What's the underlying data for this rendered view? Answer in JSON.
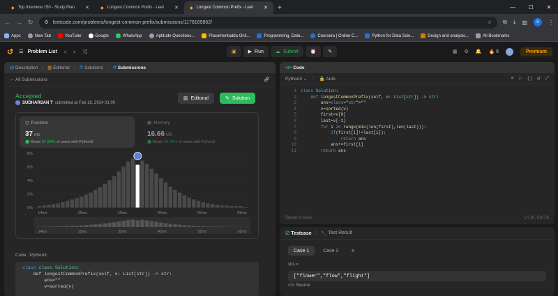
{
  "browser": {
    "tabs": [
      {
        "title": "Top Interview 150 - Study Plan",
        "active": false
      },
      {
        "title": "Longest Common Prefix - Leet",
        "active": false
      },
      {
        "title": "Longest Common Prefix - Leet",
        "active": true
      }
    ],
    "url": "leetcode.com/problems/longest-common-prefix/submissions/1178189862/",
    "profile_initial": "S",
    "bookmarks": [
      "Apps",
      "New Tab",
      "YouTube",
      "Google",
      "WhatsApp",
      "Aptitude Questions...",
      "Placementadda Onli...",
      "Programming, Data...",
      "Coursera | Online C...",
      "Python for Data Scie...",
      "Design and analysis..."
    ],
    "all_bookmarks": "All Bookmarks"
  },
  "header": {
    "problem_list": "Problem List",
    "run": "Run",
    "submit": "Submit",
    "streak": "0",
    "premium": "Premium"
  },
  "left": {
    "tabs": [
      "Description",
      "Editorial",
      "Solutions",
      "Submissions"
    ],
    "all_submissions": "All Submissions",
    "status": "Accepted",
    "user": "SUDHARSAN T",
    "submitted_text": "submitted at Feb 18, 2024 01:00",
    "editorial_btn": "Editorial",
    "solution_btn": "Solution",
    "runtime": {
      "label": "Runtime",
      "value": "37",
      "unit": "ms",
      "beats_prefix": "Beats",
      "beats_pct": "67.96%",
      "beats_suffix": "of users with Python3"
    },
    "memory": {
      "label": "Memory",
      "value": "16.66",
      "unit": "MB",
      "beats_prefix": "Beats",
      "beats_pct": "49.85%",
      "beats_suffix": "of users with Python3"
    },
    "code_label": "Code",
    "code_lang": "Python3",
    "code_preview": [
      "class Solution:",
      "    def longestCommonPrefix(self, v: List[str]) -> str:",
      "        ans=\"\"",
      "        v=sorted(v)"
    ]
  },
  "chart_data": {
    "type": "bar",
    "title": "",
    "xlabel": "",
    "ylabel": "",
    "y_ticks": [
      "8%",
      "6%",
      "4%",
      "2%",
      "0%"
    ],
    "ylim": [
      0,
      8
    ],
    "x_ticks": [
      "14ms",
      "25ms",
      "35ms",
      "45ms",
      "55ms",
      "65ms"
    ],
    "highlight_bar_value": 6.3,
    "bar_values": [
      0.2,
      0.3,
      0.4,
      0.5,
      0.6,
      0.8,
      1.0,
      1.2,
      1.4,
      1.6,
      1.9,
      2.2,
      2.6,
      3.0,
      3.5,
      4.0,
      4.6,
      5.3,
      6.0,
      6.8,
      7.2,
      6.3,
      6.9,
      6.4,
      5.7,
      5.0,
      4.3,
      3.7,
      3.1,
      2.6,
      2.2,
      1.8,
      1.5,
      1.2,
      1.0,
      0.8,
      0.6,
      0.5,
      0.4,
      0.3,
      0.3,
      0.2,
      0.2,
      0.2,
      0.1
    ],
    "mini_ticks": [
      "14ms",
      "25ms",
      "35ms",
      "45ms",
      "55ms",
      "65ms"
    ]
  },
  "editor": {
    "title": "Code",
    "lang": "Python3",
    "mode": "Auto",
    "saved": "Saved to local",
    "position": "Ln 10, Col 26",
    "lines": [
      "class Solution:",
      "    def longestCommonPrefix(self, v: List[str]) -> str:",
      "        ans=\"\"",
      "        v=sorted(v)",
      "        first=v[0]",
      "        last=v[-1]",
      "        for i in range(min(len(first),len(last))):",
      "            if(first[i]!=last[i]):",
      "                return ans",
      "            ans+=first[i]",
      "        return ans"
    ]
  },
  "testcase": {
    "tab_active": "Testcase",
    "tab_other": "Test Result",
    "cases": [
      "Case 1",
      "Case 2"
    ],
    "var_label": "strs =",
    "value": "[\"flower\",\"flow\",\"flight\"]",
    "source": "Source"
  }
}
